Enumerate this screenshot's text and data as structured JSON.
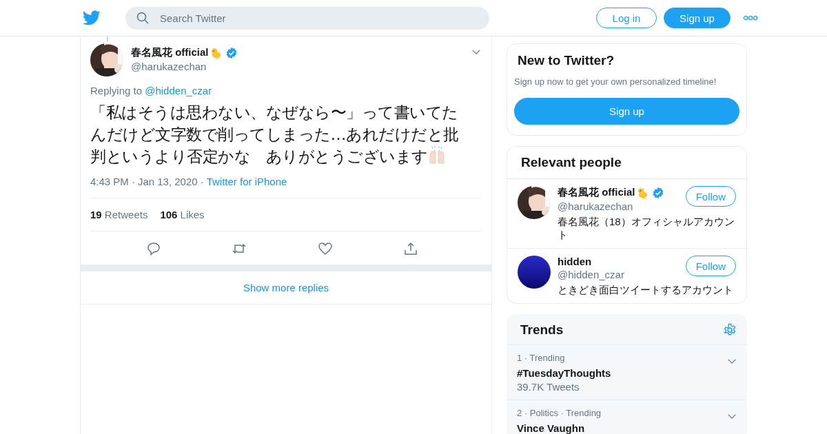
{
  "header": {
    "search": {
      "placeholder": "Search Twitter"
    },
    "login": "Log in",
    "signup": "Sign up"
  },
  "tweet": {
    "name": "春名風花 official",
    "chick_icon": true,
    "verified": true,
    "handle": "@harukazechan",
    "replying_prefix": "Replying to",
    "replying_to": "@hidden_czar",
    "text": "「私はそうは思わない、なぜなら〜」って書いてたんだけど文字数で削ってしまった…あれだけだと批判というより否定かな　ありがとうございます",
    "hands_icon": true,
    "time": "4:43 PM",
    "separator": "·",
    "date": "Jan 13, 2020",
    "source": "Twitter for iPhone",
    "stats": [
      {
        "count": "19",
        "label": "Retweets"
      },
      {
        "count": "106",
        "label": "Likes"
      }
    ],
    "show_more": "Show more replies"
  },
  "signup_card": {
    "title": "New to Twitter?",
    "text": "Sign up now to get your own personalized timeline!",
    "button": "Sign up"
  },
  "people": {
    "title": "Relevant people",
    "items": [
      {
        "name": "春名風花 official",
        "chick_icon": true,
        "verified": true,
        "handle": "@harukazechan",
        "bio": "春名風花（18）オフィシャルアカウント",
        "follow": "Follow"
      },
      {
        "kind": "plain",
        "name": "hidden",
        "chick_icon": false,
        "verified": false,
        "handle": "@hidden_czar",
        "bio": "ときどき面白ツイートするアカウント",
        "follow": "Follow"
      }
    ]
  },
  "trends": {
    "title": "Trends",
    "items": [
      {
        "meta": "1 · Trending",
        "name": "#TuesdayThoughts",
        "count": "39.7K Tweets"
      },
      {
        "meta": "2 · Politics · Trending",
        "name": "Vince Vaughn"
      }
    ]
  }
}
